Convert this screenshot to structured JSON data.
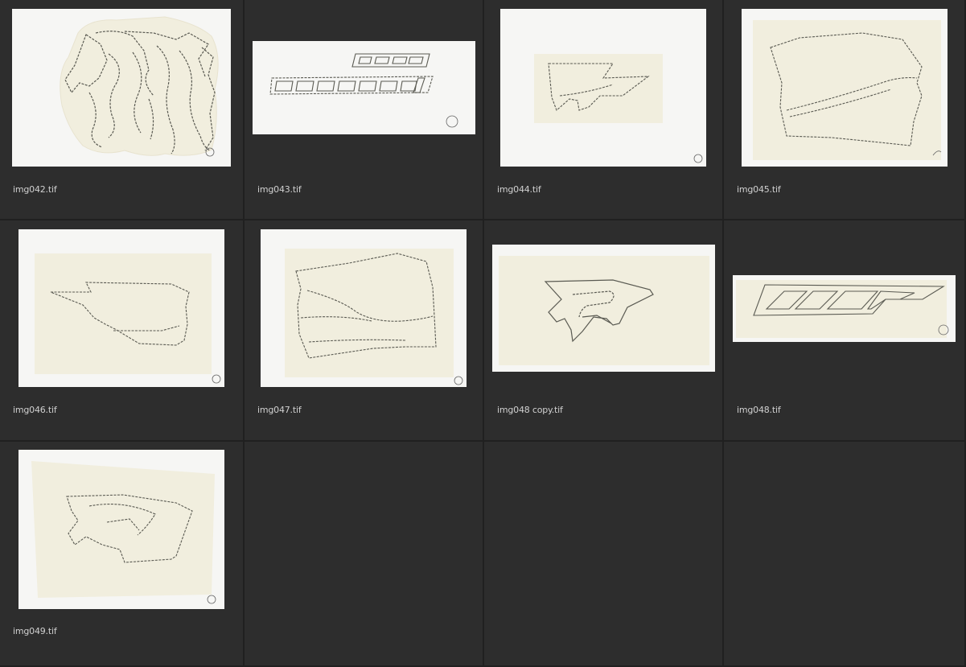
{
  "colors": {
    "background": "#2b2b2b",
    "cell": "#2d2d2d",
    "grid_line": "#202020",
    "label": "#d0d0d0",
    "paper": "#f6f6f4",
    "tracing": "#f1eede",
    "pencil": "#5a5a52"
  },
  "gallery": {
    "items": [
      {
        "filename": "img042.tif",
        "icon": "sketch-zebra-stripes-thumbnail"
      },
      {
        "filename": "img043.tif",
        "icon": "sketch-lettering-thumbnail"
      },
      {
        "filename": "img044.tif",
        "icon": "sketch-arrow-panel-thumbnail"
      },
      {
        "filename": "img045.tif",
        "icon": "sketch-panel-outline-thumbnail"
      },
      {
        "filename": "img046.tif",
        "icon": "sketch-arrow-shape-thumbnail"
      },
      {
        "filename": "img047.tif",
        "icon": "sketch-side-panel-thumbnail"
      },
      {
        "filename": "img048 copy.tif",
        "icon": "sketch-r-logo-thumbnail"
      },
      {
        "filename": "img048.tif",
        "icon": "sketch-stripe-decal-thumbnail"
      },
      {
        "filename": "img049.tif",
        "icon": "sketch-swoosh-thumbnail"
      }
    ]
  }
}
